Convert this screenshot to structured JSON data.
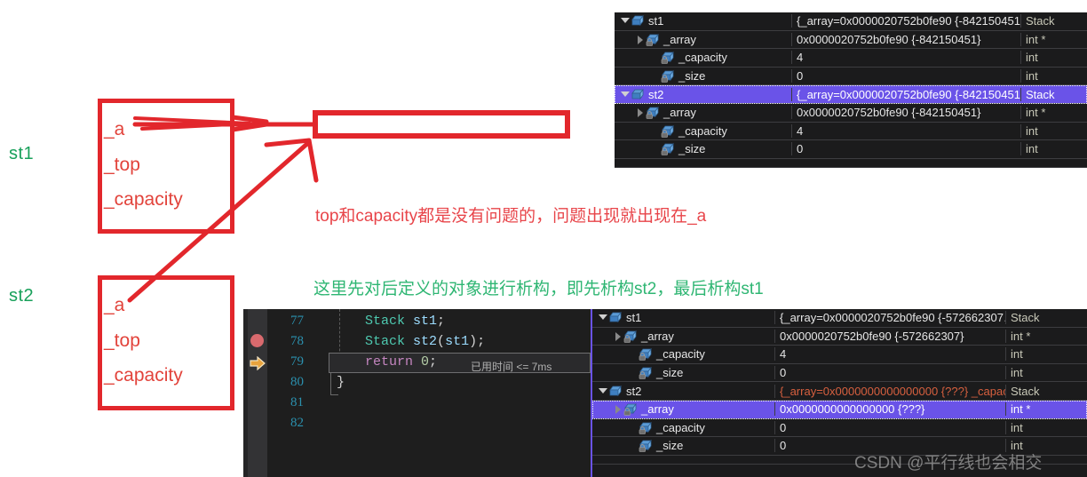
{
  "diagram": {
    "st1_label": "st1",
    "st2_label": "st2",
    "fields": [
      "_a",
      "_top",
      "_capacity"
    ],
    "box1_fields": [
      "_a",
      "_top",
      "_capacity"
    ],
    "box2_fields": [
      "_a",
      "_top",
      "_capacity"
    ]
  },
  "notes": {
    "red_note": "top和capacity都是没有问题的，问题出现就出现在_a",
    "green_note": "这里先对后定义的对象进行析构，即先析构st2，最后析构st1",
    "red_color": "#e8454a",
    "green_color": "#2fb673",
    "box_color": "#e2272c"
  },
  "watch_top": {
    "rows": [
      {
        "indent": 0,
        "expander": "open",
        "icon": "object-cube-icon",
        "name": "st1",
        "value": "{_array=0x0000020752b0fe90 {-842150451…",
        "type": "Stack",
        "selected": false,
        "changed": false
      },
      {
        "indent": 1,
        "expander": "closed",
        "icon": "field-lock-icon",
        "name": "_array",
        "value": "0x0000020752b0fe90 {-842150451}",
        "type": "int *",
        "selected": false,
        "changed": false
      },
      {
        "indent": 2,
        "expander": "none",
        "icon": "field-lock-icon",
        "name": "_capacity",
        "value": "4",
        "type": "int",
        "selected": false,
        "changed": false
      },
      {
        "indent": 2,
        "expander": "none",
        "icon": "field-lock-icon",
        "name": "_size",
        "value": "0",
        "type": "int",
        "selected": false,
        "changed": false
      },
      {
        "indent": 0,
        "expander": "open",
        "icon": "object-cube-icon",
        "name": "st2",
        "value": "{_array=0x0000020752b0fe90 {-842150451…",
        "type": "Stack",
        "selected": true,
        "changed": false
      },
      {
        "indent": 1,
        "expander": "closed",
        "icon": "field-lock-icon",
        "name": "_array",
        "value": "0x0000020752b0fe90 {-842150451}",
        "type": "int *",
        "selected": false,
        "changed": false
      },
      {
        "indent": 2,
        "expander": "none",
        "icon": "field-lock-icon",
        "name": "_capacity",
        "value": "4",
        "type": "int",
        "selected": false,
        "changed": false
      },
      {
        "indent": 2,
        "expander": "none",
        "icon": "field-lock-icon",
        "name": "_size",
        "value": "0",
        "type": "int",
        "selected": false,
        "changed": false
      }
    ]
  },
  "watch_bottom": {
    "rows": [
      {
        "indent": 0,
        "expander": "open",
        "icon": "object-cube-icon",
        "name": "st1",
        "value": "{_array=0x0000020752b0fe90 {-572662307…",
        "type": "Stack",
        "selected": false,
        "changed": false
      },
      {
        "indent": 1,
        "expander": "closed",
        "icon": "field-lock-icon",
        "name": "_array",
        "value": "0x0000020752b0fe90 {-572662307}",
        "type": "int *",
        "selected": false,
        "changed": false
      },
      {
        "indent": 2,
        "expander": "none",
        "icon": "field-lock-icon",
        "name": "_capacity",
        "value": "4",
        "type": "int",
        "selected": false,
        "changed": false
      },
      {
        "indent": 2,
        "expander": "none",
        "icon": "field-lock-icon",
        "name": "_size",
        "value": "0",
        "type": "int",
        "selected": false,
        "changed": false
      },
      {
        "indent": 0,
        "expander": "open",
        "icon": "object-cube-icon",
        "name": "st2",
        "value": "{_array=0x0000000000000000 {???} _capac…",
        "type": "Stack",
        "selected": false,
        "changed": true
      },
      {
        "indent": 1,
        "expander": "closed",
        "icon": "field-lock-icon",
        "name": "_array",
        "value": "0x0000000000000000 {???}",
        "type": "int *",
        "selected": true,
        "changed": true
      },
      {
        "indent": 2,
        "expander": "none",
        "icon": "field-lock-icon",
        "name": "_capacity",
        "value": "0",
        "type": "int",
        "selected": false,
        "changed": false
      },
      {
        "indent": 2,
        "expander": "none",
        "icon": "field-lock-icon",
        "name": "_size",
        "value": "0",
        "type": "int",
        "selected": false,
        "changed": false
      }
    ]
  },
  "editor": {
    "line_numbers": [
      "77",
      "78",
      "79",
      "80",
      "81",
      "82"
    ],
    "lines": [
      {
        "num": "77",
        "tokens": [
          {
            "t": "Stack",
            "c": "type"
          },
          {
            "t": " ",
            "c": "pun"
          },
          {
            "t": "st1",
            "c": "id"
          },
          {
            "t": ";",
            "c": "pun"
          }
        ]
      },
      {
        "num": "78",
        "tokens": [
          {
            "t": "Stack",
            "c": "type"
          },
          {
            "t": " ",
            "c": "pun"
          },
          {
            "t": "st2",
            "c": "id"
          },
          {
            "t": "(",
            "c": "pun"
          },
          {
            "t": "st1",
            "c": "id"
          },
          {
            "t": ")",
            "c": "pun"
          },
          {
            "t": ";",
            "c": "pun"
          }
        ]
      },
      {
        "num": "79",
        "tokens": [
          {
            "t": "return",
            "c": "kw"
          },
          {
            "t": " ",
            "c": "pun"
          },
          {
            "t": "0",
            "c": "num"
          },
          {
            "t": ";",
            "c": "pun"
          }
        ]
      },
      {
        "num": "80",
        "tokens": [
          {
            "t": "}",
            "c": "pun"
          }
        ]
      },
      {
        "num": "81",
        "tokens": []
      },
      {
        "num": "82",
        "tokens": []
      }
    ],
    "elapsed_label": "已用时间 <= 7ms",
    "breakpoint_icon": "breakpoint-icon",
    "current_line_icon": "execution-pointer-icon"
  },
  "watermark": {
    "text": "CSDN @平行线也会相交"
  }
}
